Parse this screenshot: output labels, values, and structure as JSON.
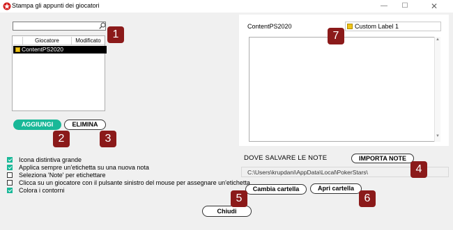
{
  "window": {
    "title": "Stampa gli appunti dei giocatori",
    "minimize": "—",
    "maximize": "☐",
    "close": "✕"
  },
  "search": {
    "value": "",
    "placeholder": ""
  },
  "player_list": {
    "columns": [
      "",
      "Giocatore",
      "Modificato"
    ],
    "rows": [
      {
        "color": "#f0c419",
        "name": "ContentPS2020",
        "modified": ""
      }
    ]
  },
  "buttons": {
    "add": "AGGIUNGI",
    "delete": "ELIMINA",
    "import_notes": "IMPORTA NOTE",
    "change_folder": "Cambia cartella",
    "open_folder": "Apri cartella",
    "close": "Chiudi"
  },
  "options": [
    {
      "label": "Icona distintiva grande",
      "checked": true
    },
    {
      "label": "Applica sempre un'etichetta su una nuova nota",
      "checked": true
    },
    {
      "label": "Seleziona 'Note' per etichettare",
      "checked": false
    },
    {
      "label": "Clicca su un giocatore con il pulsante sinistro del mouse per assegnare un'etichetta",
      "checked": false
    },
    {
      "label": "Colora i contorni",
      "checked": true
    }
  ],
  "notes_panel": {
    "player": "ContentPS2020",
    "label_select": {
      "color": "#f0c419",
      "value": "Custom Label 1"
    },
    "notes_text": ""
  },
  "save": {
    "heading": "DOVE SALVARE LE NOTE",
    "path": "C:\\Users\\krupdani\\AppData\\Local\\PokerStars\\"
  },
  "badges": [
    "1",
    "2",
    "3",
    "4",
    "5",
    "6",
    "7"
  ],
  "colors": {
    "accent": "#19b898",
    "badge": "#8b1a1a",
    "label_yellow": "#f0c419"
  }
}
